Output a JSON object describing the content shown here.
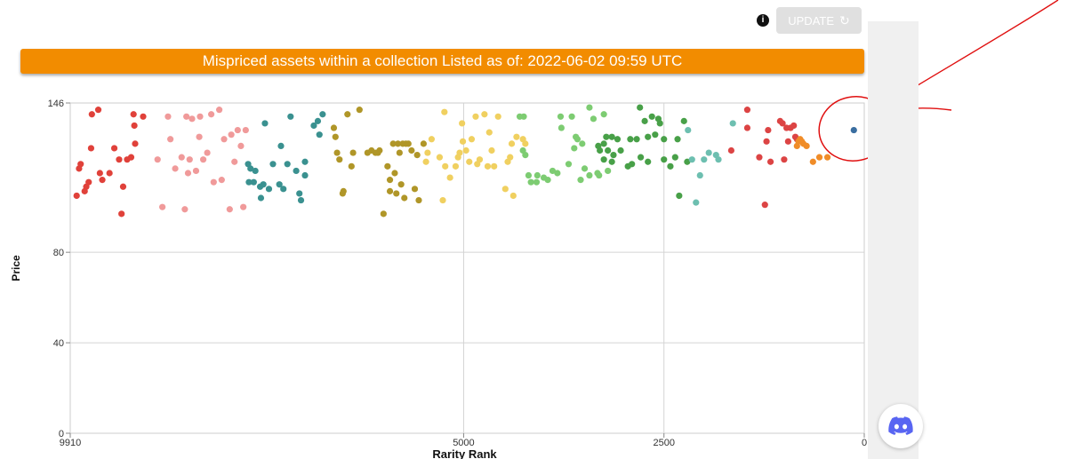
{
  "header": {
    "info_icon": "info-icon",
    "update_label": "UPDATE",
    "refresh_icon": "refresh-icon"
  },
  "banner": {
    "text": "Mispriced assets within a collection Listed as of: 2022-06-02 09:59 UTC",
    "color": "#f28c00"
  },
  "discord": {
    "icon": "discord-icon",
    "color": "#5865f2"
  },
  "annotation_color": "#e01010",
  "chart_data": {
    "type": "scatter",
    "xlabel": "Rarity Rank",
    "ylabel": "Price",
    "xlim": [
      9910,
      0
    ],
    "ylim": [
      0,
      146
    ],
    "x_ticks": [
      9910,
      5000,
      2500,
      0
    ],
    "y_ticks": [
      0,
      40,
      80,
      146
    ],
    "grid": true,
    "series": [
      {
        "color": "#e0413a",
        "points": [
          [
            9830,
            105
          ],
          [
            9800,
            117
          ],
          [
            9780,
            119
          ],
          [
            9730,
            107
          ],
          [
            9710,
            109
          ],
          [
            9680,
            111
          ],
          [
            9650,
            126
          ],
          [
            9640,
            141
          ],
          [
            9560,
            143
          ],
          [
            9540,
            115
          ],
          [
            9510,
            112
          ],
          [
            9420,
            115
          ],
          [
            9360,
            126
          ],
          [
            9300,
            121
          ],
          [
            9270,
            97
          ],
          [
            9250,
            109
          ],
          [
            9200,
            121
          ],
          [
            9150,
            122
          ],
          [
            9120,
            141
          ],
          [
            9110,
            136
          ],
          [
            9100,
            128
          ],
          [
            9000,
            140
          ]
        ]
      },
      {
        "color": "#f09a9a",
        "points": [
          [
            8760,
            100
          ],
          [
            8820,
            121
          ],
          [
            8690,
            140
          ],
          [
            8660,
            130
          ],
          [
            8600,
            117
          ],
          [
            8520,
            122
          ],
          [
            8480,
            99
          ],
          [
            8460,
            140
          ],
          [
            8440,
            115
          ],
          [
            8420,
            121
          ],
          [
            8390,
            139
          ],
          [
            8340,
            116
          ],
          [
            8300,
            131
          ],
          [
            8290,
            140
          ],
          [
            8250,
            121
          ],
          [
            8200,
            124
          ],
          [
            8150,
            141
          ],
          [
            8120,
            111
          ],
          [
            8050,
            143
          ],
          [
            8020,
            112
          ],
          [
            7990,
            130
          ],
          [
            7920,
            99
          ],
          [
            7900,
            132
          ],
          [
            7860,
            120
          ],
          [
            7820,
            134
          ],
          [
            7780,
            127
          ],
          [
            7750,
            100
          ],
          [
            7720,
            134
          ]
        ]
      },
      {
        "color": "#3a9190",
        "points": [
          [
            7690,
            119
          ],
          [
            7680,
            111
          ],
          [
            7660,
            117
          ],
          [
            7620,
            111
          ],
          [
            7600,
            116
          ],
          [
            7540,
            109
          ],
          [
            7530,
            104
          ],
          [
            7500,
            110
          ],
          [
            7480,
            137
          ],
          [
            7430,
            108
          ],
          [
            7380,
            119
          ],
          [
            7300,
            110
          ],
          [
            7280,
            127
          ],
          [
            7250,
            108
          ],
          [
            7200,
            119
          ],
          [
            7160,
            140
          ],
          [
            7090,
            116
          ],
          [
            7050,
            106
          ],
          [
            7030,
            103
          ],
          [
            6980,
            114
          ],
          [
            6980,
            120
          ],
          [
            6870,
            136
          ],
          [
            6820,
            138
          ],
          [
            6800,
            132
          ],
          [
            6760,
            141
          ]
        ]
      },
      {
        "color": "#b09628",
        "points": [
          [
            6620,
            135
          ],
          [
            6600,
            131
          ],
          [
            6580,
            124
          ],
          [
            6550,
            121
          ],
          [
            6510,
            106
          ],
          [
            6500,
            107
          ],
          [
            6450,
            141
          ],
          [
            6400,
            118
          ],
          [
            6380,
            124
          ],
          [
            6300,
            143
          ],
          [
            6200,
            124
          ],
          [
            6150,
            125
          ],
          [
            6100,
            124
          ],
          [
            6070,
            124
          ],
          [
            6050,
            125
          ],
          [
            6000,
            97
          ],
          [
            5950,
            118
          ],
          [
            5920,
            107
          ],
          [
            5920,
            112
          ],
          [
            5880,
            128
          ],
          [
            5860,
            115
          ],
          [
            5840,
            106
          ],
          [
            5820,
            128
          ],
          [
            5800,
            124
          ],
          [
            5780,
            110
          ],
          [
            5760,
            128
          ],
          [
            5740,
            104
          ],
          [
            5720,
            128
          ],
          [
            5690,
            128
          ],
          [
            5650,
            125
          ],
          [
            5610,
            108
          ],
          [
            5580,
            123
          ],
          [
            5560,
            103
          ],
          [
            5500,
            128
          ]
        ]
      },
      {
        "color": "#f0d060",
        "points": [
          [
            5470,
            120
          ],
          [
            5450,
            124
          ],
          [
            5400,
            130
          ],
          [
            5300,
            122
          ],
          [
            5260,
            103
          ],
          [
            5240,
            142
          ],
          [
            5230,
            118
          ],
          [
            5170,
            113
          ],
          [
            5100,
            118
          ],
          [
            5070,
            122
          ],
          [
            5050,
            124
          ],
          [
            5020,
            137
          ],
          [
            5010,
            129
          ],
          [
            4970,
            125
          ],
          [
            4930,
            120
          ],
          [
            4900,
            130
          ],
          [
            4850,
            140
          ],
          [
            4830,
            119
          ],
          [
            4800,
            121
          ],
          [
            4740,
            141
          ],
          [
            4700,
            118
          ],
          [
            4680,
            133
          ],
          [
            4650,
            125
          ],
          [
            4620,
            118
          ],
          [
            4570,
            140
          ],
          [
            4480,
            108
          ],
          [
            4450,
            120
          ],
          [
            4420,
            122
          ],
          [
            4400,
            128
          ],
          [
            4380,
            105
          ],
          [
            4340,
            131
          ],
          [
            4260,
            130
          ],
          [
            4230,
            128
          ]
        ]
      },
      {
        "color": "#7dcc72",
        "points": [
          [
            4300,
            140
          ],
          [
            4260,
            125
          ],
          [
            4250,
            140
          ],
          [
            4230,
            123
          ],
          [
            4190,
            114
          ],
          [
            4160,
            111
          ],
          [
            4090,
            111
          ],
          [
            4080,
            114
          ],
          [
            4000,
            113
          ],
          [
            3950,
            112
          ],
          [
            3890,
            116
          ],
          [
            3830,
            115
          ],
          [
            3790,
            140
          ],
          [
            3780,
            135
          ],
          [
            3690,
            119
          ],
          [
            3650,
            140
          ],
          [
            3620,
            126
          ],
          [
            3600,
            131
          ],
          [
            3580,
            130
          ],
          [
            3540,
            112
          ],
          [
            3520,
            128
          ],
          [
            3490,
            117
          ],
          [
            3430,
            144
          ],
          [
            3430,
            114
          ],
          [
            3380,
            139
          ],
          [
            3330,
            115
          ],
          [
            3310,
            114
          ],
          [
            3250,
            141
          ],
          [
            3200,
            116
          ]
        ]
      },
      {
        "color": "#48a048",
        "points": [
          [
            3320,
            127
          ],
          [
            3300,
            125
          ],
          [
            3250,
            128
          ],
          [
            3250,
            121
          ],
          [
            3220,
            131
          ],
          [
            3200,
            125
          ],
          [
            3150,
            120
          ],
          [
            3150,
            131
          ],
          [
            3130,
            123
          ],
          [
            3080,
            130
          ],
          [
            3040,
            125
          ],
          [
            2950,
            118
          ],
          [
            2920,
            130
          ],
          [
            2900,
            119
          ],
          [
            2840,
            130
          ],
          [
            2800,
            144
          ],
          [
            2790,
            122
          ],
          [
            2740,
            138
          ],
          [
            2700,
            120
          ],
          [
            2700,
            131
          ],
          [
            2650,
            140
          ],
          [
            2610,
            132
          ],
          [
            2570,
            139
          ],
          [
            2550,
            137
          ],
          [
            2500,
            130
          ],
          [
            2500,
            121
          ],
          [
            2420,
            118
          ],
          [
            2360,
            122
          ],
          [
            2330,
            130
          ],
          [
            2310,
            105
          ],
          [
            2250,
            138
          ],
          [
            2210,
            120
          ]
        ]
      },
      {
        "color": "#6dbfb0",
        "points": [
          [
            2200,
            134
          ],
          [
            2150,
            121
          ],
          [
            2100,
            102
          ],
          [
            2050,
            114
          ],
          [
            2000,
            121
          ],
          [
            1940,
            124
          ],
          [
            1850,
            123
          ],
          [
            1820,
            121
          ],
          [
            1640,
            137
          ]
        ]
      },
      {
        "color": "#dc4444",
        "points": [
          [
            1660,
            125
          ],
          [
            1460,
            143
          ],
          [
            1460,
            135
          ],
          [
            1310,
            122
          ],
          [
            1240,
            101
          ],
          [
            1220,
            129
          ],
          [
            1200,
            134
          ],
          [
            1170,
            120
          ],
          [
            1050,
            138
          ],
          [
            1020,
            137
          ],
          [
            1000,
            121
          ],
          [
            970,
            135
          ],
          [
            950,
            129
          ],
          [
            920,
            135
          ],
          [
            880,
            136
          ],
          [
            860,
            131
          ],
          [
            840,
            130
          ]
        ]
      },
      {
        "color": "#f08c28",
        "points": [
          [
            840,
            127
          ],
          [
            820,
            129
          ],
          [
            800,
            130
          ],
          [
            780,
            129
          ],
          [
            760,
            128
          ],
          [
            720,
            127
          ],
          [
            640,
            120
          ],
          [
            560,
            122
          ],
          [
            460,
            122
          ]
        ]
      },
      {
        "color": "#3a6ea0",
        "points": [
          [
            130,
            134
          ]
        ]
      }
    ]
  }
}
